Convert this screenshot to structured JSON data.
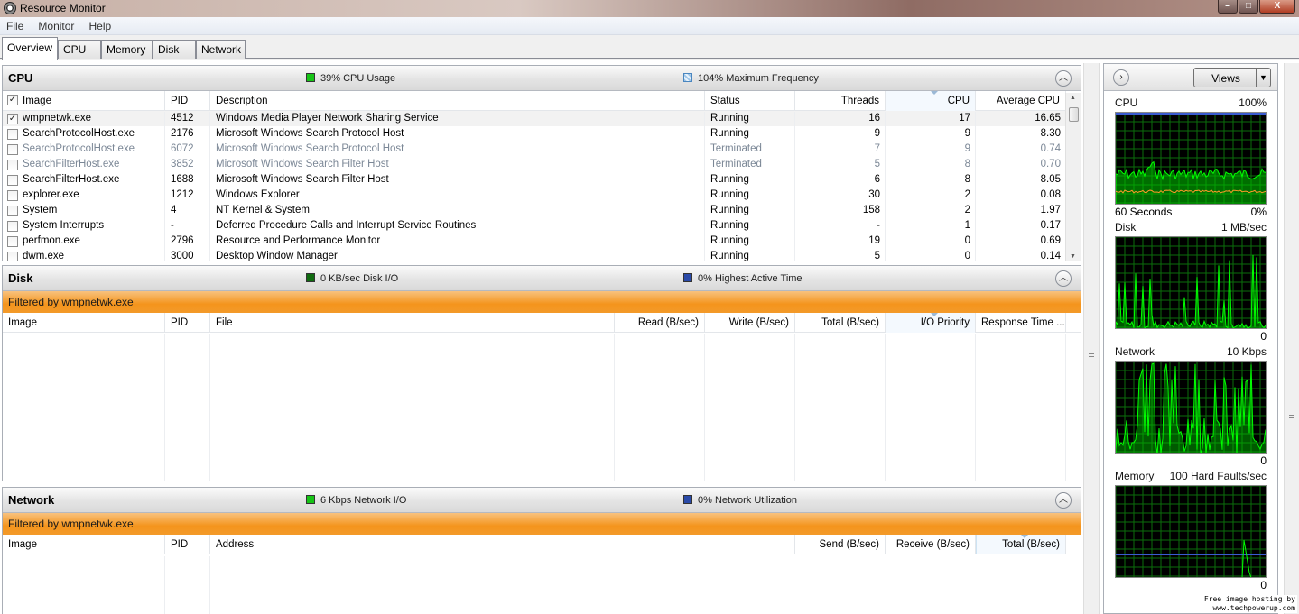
{
  "window": {
    "title": "Resource Monitor",
    "buttons": {
      "minimize": "–",
      "maximize": "□",
      "close": "X"
    }
  },
  "menu": [
    "File",
    "Monitor",
    "Help"
  ],
  "tabs": [
    "Overview",
    "CPU",
    "Memory",
    "Disk",
    "Network"
  ],
  "cpu": {
    "title": "CPU",
    "usage_text": "39% CPU Usage",
    "freq_text": "104% Maximum Frequency",
    "columns": [
      "Image",
      "PID",
      "Description",
      "Status",
      "Threads",
      "CPU",
      "Average CPU"
    ],
    "rows": [
      {
        "checked": true,
        "image": "wmpnetwk.exe",
        "pid": "4512",
        "description": "Windows Media Player Network Sharing Service",
        "status": "Running",
        "threads": "16",
        "cpu": "17",
        "avg": "16.65",
        "terminated": false
      },
      {
        "checked": false,
        "image": "SearchProtocolHost.exe",
        "pid": "2176",
        "description": "Microsoft Windows Search Protocol Host",
        "status": "Running",
        "threads": "9",
        "cpu": "9",
        "avg": "8.30",
        "terminated": false
      },
      {
        "checked": false,
        "image": "SearchProtocolHost.exe",
        "pid": "6072",
        "description": "Microsoft Windows Search Protocol Host",
        "status": "Terminated",
        "threads": "7",
        "cpu": "9",
        "avg": "0.74",
        "terminated": true
      },
      {
        "checked": false,
        "image": "SearchFilterHost.exe",
        "pid": "3852",
        "description": "Microsoft Windows Search Filter Host",
        "status": "Terminated",
        "threads": "5",
        "cpu": "8",
        "avg": "0.70",
        "terminated": true
      },
      {
        "checked": false,
        "image": "SearchFilterHost.exe",
        "pid": "1688",
        "description": "Microsoft Windows Search Filter Host",
        "status": "Running",
        "threads": "6",
        "cpu": "8",
        "avg": "8.05",
        "terminated": false
      },
      {
        "checked": false,
        "image": "explorer.exe",
        "pid": "1212",
        "description": "Windows Explorer",
        "status": "Running",
        "threads": "30",
        "cpu": "2",
        "avg": "0.08",
        "terminated": false
      },
      {
        "checked": false,
        "image": "System",
        "pid": "4",
        "description": "NT Kernel & System",
        "status": "Running",
        "threads": "158",
        "cpu": "2",
        "avg": "1.97",
        "terminated": false
      },
      {
        "checked": false,
        "image": "System Interrupts",
        "pid": "-",
        "description": "Deferred Procedure Calls and Interrupt Service Routines",
        "status": "Running",
        "threads": "-",
        "cpu": "1",
        "avg": "0.17",
        "terminated": false
      },
      {
        "checked": false,
        "image": "perfmon.exe",
        "pid": "2796",
        "description": "Resource and Performance Monitor",
        "status": "Running",
        "threads": "19",
        "cpu": "0",
        "avg": "0.69",
        "terminated": false
      },
      {
        "checked": false,
        "image": "dwm.exe",
        "pid": "3000",
        "description": "Desktop Window Manager",
        "status": "Running",
        "threads": "5",
        "cpu": "0",
        "avg": "0.14",
        "terminated": false
      }
    ]
  },
  "disk": {
    "title": "Disk",
    "io_text": "0 KB/sec Disk I/O",
    "active_text": "0% Highest Active Time",
    "filter_text": "Filtered by wmpnetwk.exe",
    "columns": [
      "Image",
      "PID",
      "File",
      "Read (B/sec)",
      "Write (B/sec)",
      "Total (B/sec)",
      "I/O Priority",
      "Response Time ..."
    ]
  },
  "network": {
    "title": "Network",
    "io_text": "6 Kbps Network I/O",
    "util_text": "0% Network Utilization",
    "filter_text": "Filtered by wmpnetwk.exe",
    "columns": [
      "Image",
      "PID",
      "Address",
      "Send (B/sec)",
      "Receive (B/sec)",
      "Total (B/sec)"
    ]
  },
  "graphs": {
    "views_label": "Views",
    "cpu": {
      "label": "CPU",
      "max": "100%",
      "foot_left": "60 Seconds",
      "foot_right": "0%"
    },
    "disk": {
      "label": "Disk",
      "max": "1 MB/sec",
      "foot_right": "0"
    },
    "network": {
      "label": "Network",
      "max": "10 Kbps",
      "foot_right": "0"
    },
    "memory": {
      "label": "Memory",
      "max": "100 Hard Faults/sec",
      "foot_right": "0"
    }
  },
  "watermark": {
    "line1": "Free image hosting by",
    "line2": "www.techpowerup.com"
  },
  "colors": {
    "accent_orange": "#f4941c",
    "graph_green": "#00ff00",
    "graph_bg": "#000000",
    "grid": "#0b7a0b"
  }
}
